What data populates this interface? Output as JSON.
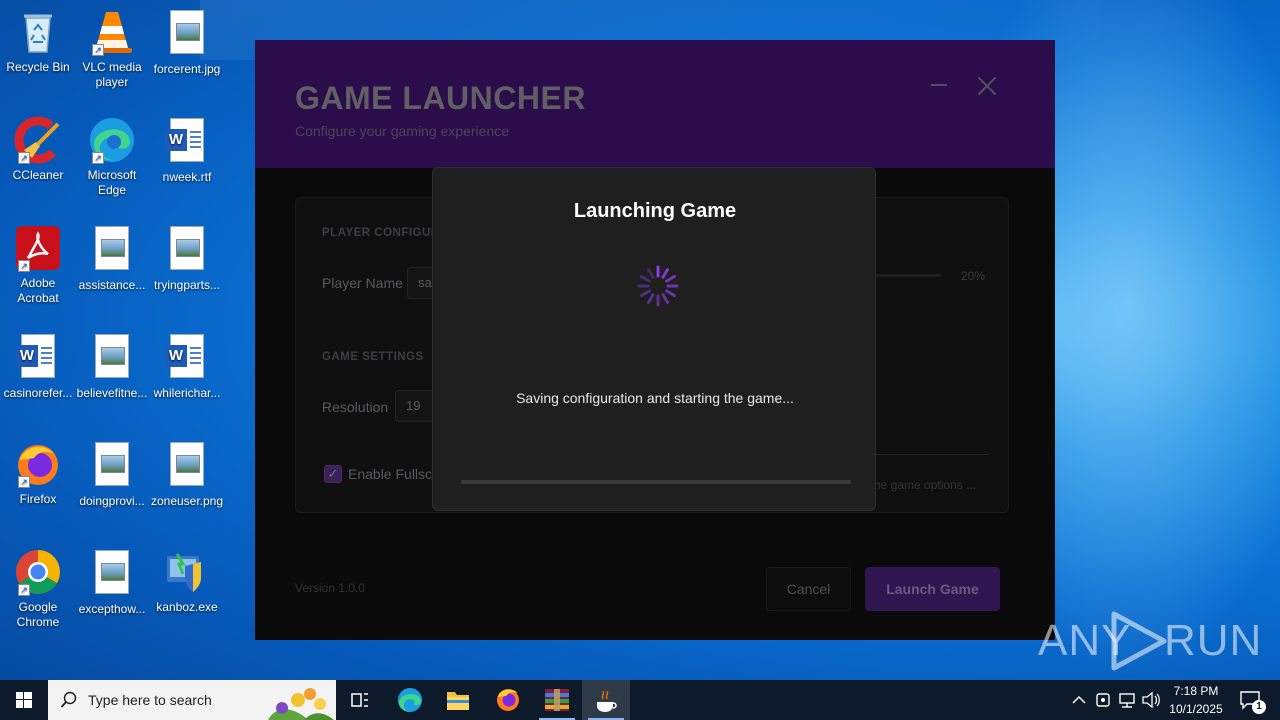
{
  "desktop": {
    "icons": [
      {
        "label": "Recycle Bin"
      },
      {
        "label": "VLC media player"
      },
      {
        "label": "forcerent.jpg"
      },
      {
        "label": "CCleaner"
      },
      {
        "label": "Microsoft Edge"
      },
      {
        "label": "nweek.rtf"
      },
      {
        "label": "Adobe Acrobat"
      },
      {
        "label": "assistance..."
      },
      {
        "label": "tryingparts..."
      },
      {
        "label": "casinorefer..."
      },
      {
        "label": "believefitne..."
      },
      {
        "label": "whilerichar..."
      },
      {
        "label": "Firefox"
      },
      {
        "label": "doingprovi..."
      },
      {
        "label": "zoneuser.png"
      },
      {
        "label": "Google Chrome"
      },
      {
        "label": "excepthow..."
      },
      {
        "label": "kanboz.exe"
      }
    ]
  },
  "launcher": {
    "title": "GAME LAUNCHER",
    "subtitle": "Configure your gaming experience",
    "player_section": "PLAYER CONFIGURA",
    "player_name_label": "Player Name",
    "player_name_value": "sa",
    "slider_value": "20%",
    "slider_level": 0.2,
    "game_settings_section": "GAME SETTINGS",
    "resolution_label": "Resolution",
    "resolution_value": "19",
    "fullscreen_label": "Enable Fullsc",
    "fullscreen_checked": true,
    "options_hint": "he game options ...",
    "version": "Version 1.0.0",
    "cancel_label": "Cancel",
    "launch_label": "Launch Game",
    "accent_color": "#2a0d4a"
  },
  "modal": {
    "title": "Launching Game",
    "message": "Saving configuration and starting the game...",
    "progress": 0,
    "spinner_color": "#8a3ee0"
  },
  "watermark": {
    "left": "ANY",
    "right": "RUN"
  },
  "taskbar": {
    "search_placeholder": "Type here to search",
    "time": "7:18 PM",
    "date": "10/1/2025",
    "notification_count": "1"
  }
}
